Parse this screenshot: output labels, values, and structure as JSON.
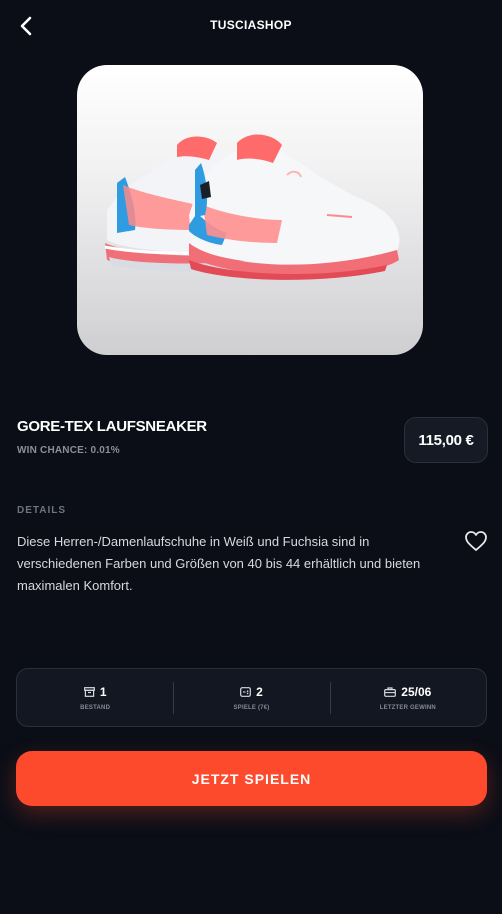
{
  "header": {
    "back_icon": "chevron-left-icon",
    "title": "TUSCIASHOP"
  },
  "product": {
    "title": "GORE-TEX LAUFSNEAKER",
    "win_chance": "WIN CHANCE: 0.01%",
    "price": "115,00 €",
    "details_label": "DETAILS",
    "description": "Diese Herren-/Damenlaufschuhe in Weiß und Fuchsia sind in verschiedenen Farben und Größen von 40 bis 44 erhältlich und bieten maximalen Komfort.",
    "favorite_icon": "heart-outline-icon"
  },
  "stats": [
    {
      "icon": "archive-box-icon",
      "value": "1",
      "label": "BESTAND"
    },
    {
      "icon": "gamepad-icon",
      "value": "2",
      "label": "SPIELE (7€)"
    },
    {
      "icon": "briefcase-icon",
      "value": "25/06",
      "label": "LETZTER GEWINN"
    }
  ],
  "cta": {
    "label": "JETZT SPIELEN"
  },
  "colors": {
    "background": "#0b0e17",
    "accent": "#fd4a2c",
    "card": "#131722",
    "muted_text": "#8b8f9a"
  }
}
